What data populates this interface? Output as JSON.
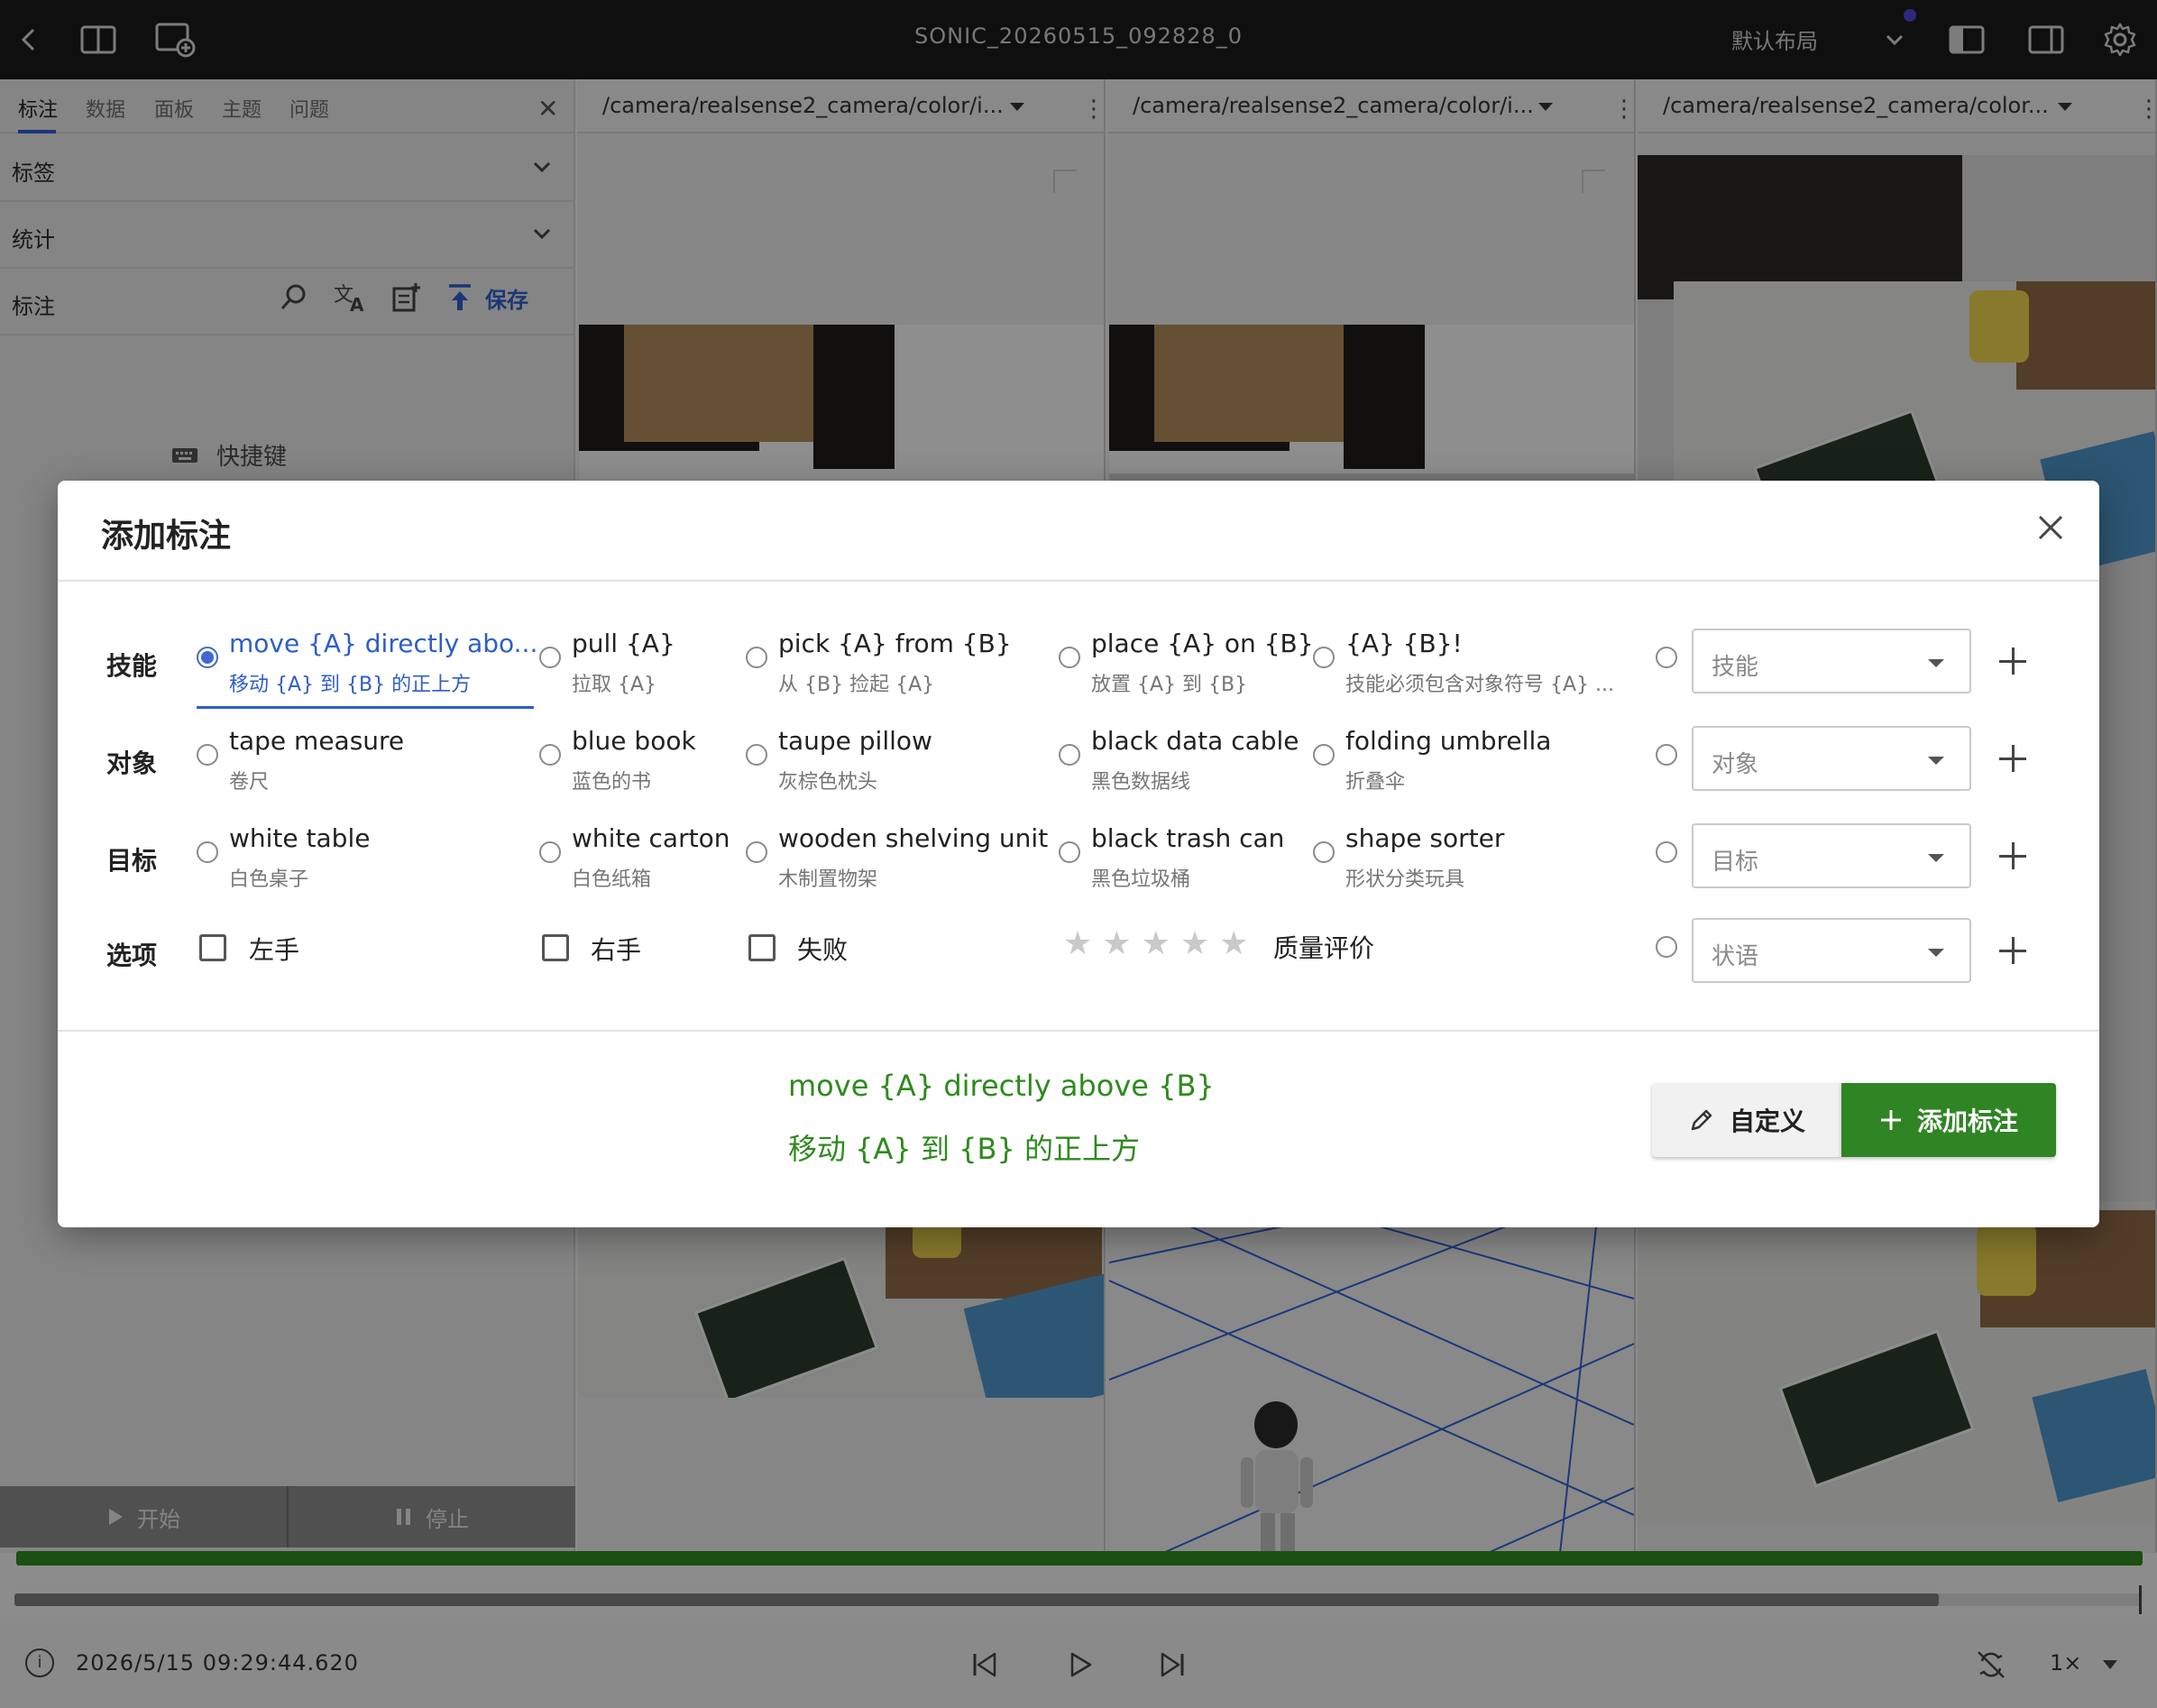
{
  "window": {
    "title": "SONIC_20260515_092828_0",
    "layout_label": "默认布局"
  },
  "left_panel": {
    "tabs": [
      "标注",
      "数据",
      "面板",
      "主题",
      "问题"
    ],
    "active_tab": "标注",
    "sections": {
      "tags": "标签",
      "stats": "统计",
      "annotation": "标注"
    },
    "save_label": "保存",
    "shortcut_label": "快捷键",
    "start_label": "开始",
    "stop_label": "停止"
  },
  "camera_panels": [
    {
      "topic": "/camera/realsense2_camera/color/i..."
    },
    {
      "topic": "/camera/realsense2_camera/color/i..."
    },
    {
      "topic": "/camera/realsense2_camera/color..."
    }
  ],
  "timeline": {
    "timestamp": "2026/5/15 09:29:44.620",
    "speed": "1×",
    "progress_fraction": 0.905
  },
  "modal": {
    "title": "添加标注",
    "rows": {
      "skill": {
        "label": "技能",
        "options": [
          {
            "en": "move {A} directly abo...",
            "zh": "移动 {A} 到 {B} 的正上方",
            "selected": true
          },
          {
            "en": "pull {A}",
            "zh": "拉取 {A}"
          },
          {
            "en": "pick {A} from {B}",
            "zh": "从 {B} 捡起 {A}"
          },
          {
            "en": "place {A} on {B}",
            "zh": "放置 {A} 到 {B}"
          },
          {
            "en": "{A} {B}!",
            "zh": "技能必须包含对象符号 {A} ..."
          }
        ],
        "dropdown_placeholder": "技能"
      },
      "object": {
        "label": "对象",
        "options": [
          {
            "en": "tape measure",
            "zh": "卷尺"
          },
          {
            "en": "blue book",
            "zh": "蓝色的书"
          },
          {
            "en": "taupe pillow",
            "zh": "灰棕色枕头"
          },
          {
            "en": "black data cable",
            "zh": "黑色数据线"
          },
          {
            "en": "folding umbrella",
            "zh": "折叠伞"
          }
        ],
        "dropdown_placeholder": "对象"
      },
      "target": {
        "label": "目标",
        "options": [
          {
            "en": "white table",
            "zh": "白色桌子"
          },
          {
            "en": "white carton",
            "zh": "白色纸箱"
          },
          {
            "en": "wooden shelving unit",
            "zh": "木制置物架"
          },
          {
            "en": "black trash can",
            "zh": "黑色垃圾桶"
          },
          {
            "en": "shape sorter",
            "zh": "形状分类玩具"
          }
        ],
        "dropdown_placeholder": "目标"
      },
      "options": {
        "label": "选项",
        "checkboxes": [
          "左手",
          "右手",
          "失败"
        ],
        "rating": 0,
        "rating_max": 5,
        "quality_label": "质量评价",
        "dropdown_placeholder": "状语"
      }
    },
    "preview": {
      "en": "move {A} directly above {B}",
      "zh": "移动 {A} 到 {B} 的正上方"
    },
    "buttons": {
      "custom": "自定义",
      "add": "添加标注"
    }
  },
  "colors": {
    "accent_blue": "#2e5ec9",
    "success_green": "#2f8424",
    "preview_green": "#2e8a1e",
    "topbar_bg": "#1b1b1d",
    "status_dot": "#4a48d8"
  }
}
